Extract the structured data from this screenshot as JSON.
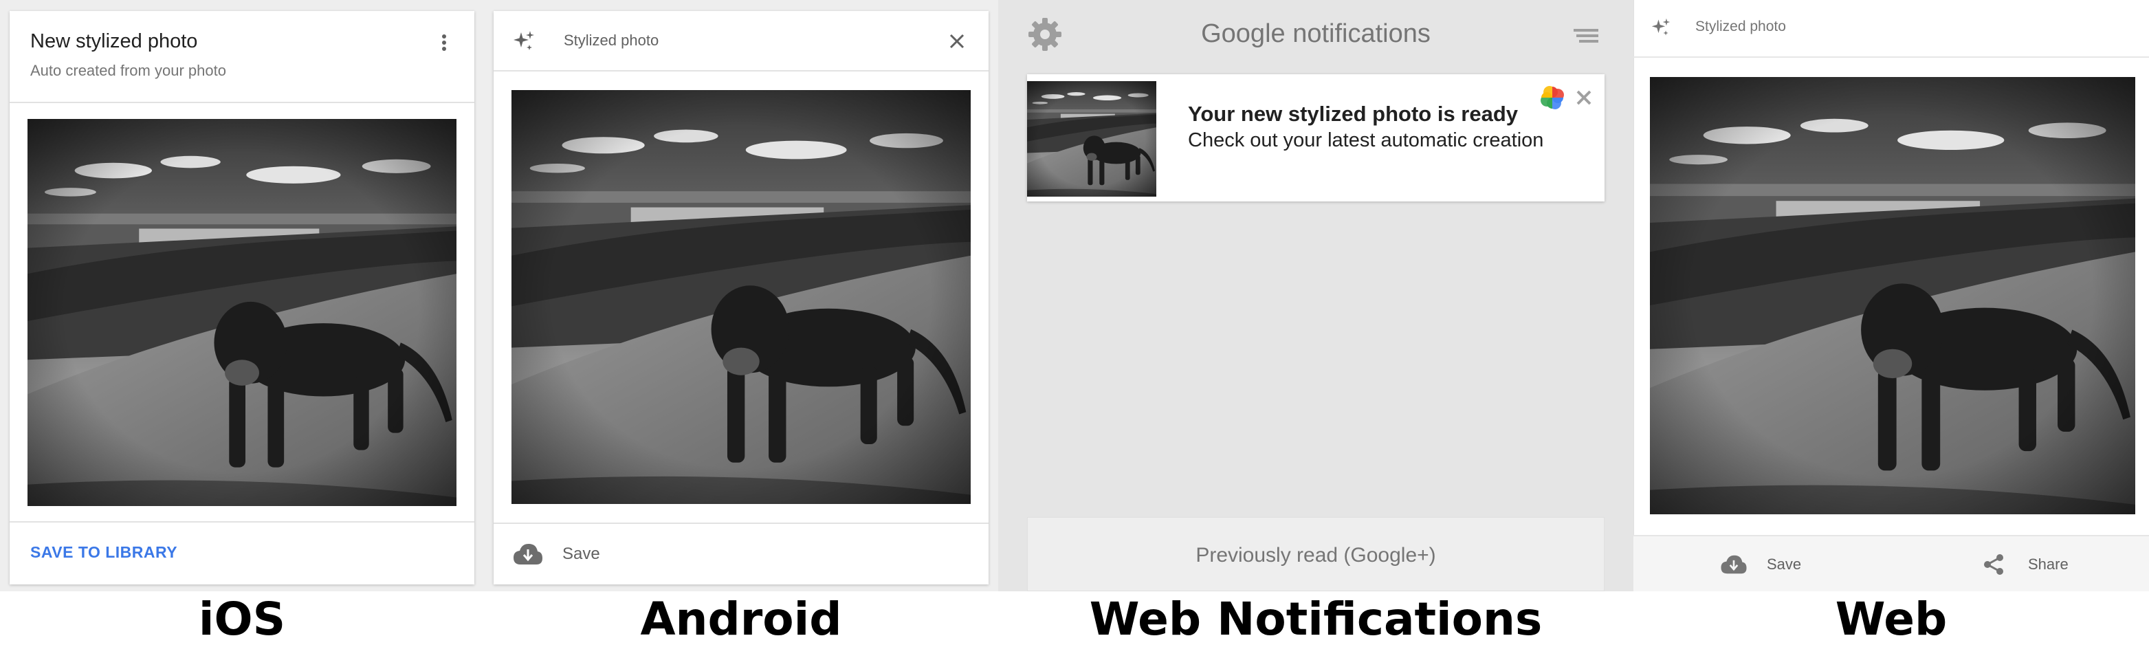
{
  "ios": {
    "card_title": "New stylized photo",
    "card_subtitle": "Auto created from your photo",
    "action_label": "SAVE TO LIBRARY",
    "platform_label": "iOS",
    "more_icon": "more-vert-icon"
  },
  "android": {
    "header_label": "Stylized photo",
    "save_label": "Save",
    "platform_label": "Android",
    "sparkle_icon": "sparkle-icon",
    "close_icon": "close-icon",
    "save_icon": "cloud-download-icon"
  },
  "web_notifications": {
    "title": "Google notifications",
    "notification_title": "Your new stylized photo is ready",
    "notification_body": "Check out your latest automatic creation",
    "previously_read": "Previously read (Google+)",
    "platform_label": "Web Notifications",
    "settings_icon": "gear-icon",
    "menu_icon": "menu-lines-icon",
    "close_icon": "close-icon",
    "photos_icon": "google-photos-pinwheel-icon"
  },
  "web": {
    "header_label": "Stylized photo",
    "save_label": "Save",
    "share_label": "Share",
    "platform_label": "Web",
    "sparkle_icon": "sparkle-icon",
    "save_icon": "cloud-download-icon",
    "share_icon": "share-icon"
  },
  "colors": {
    "link_blue": "#3b78e7",
    "notification_bg": "#e5e5e5",
    "panel_bg": "#eeeeee",
    "muted_text": "#757575"
  }
}
